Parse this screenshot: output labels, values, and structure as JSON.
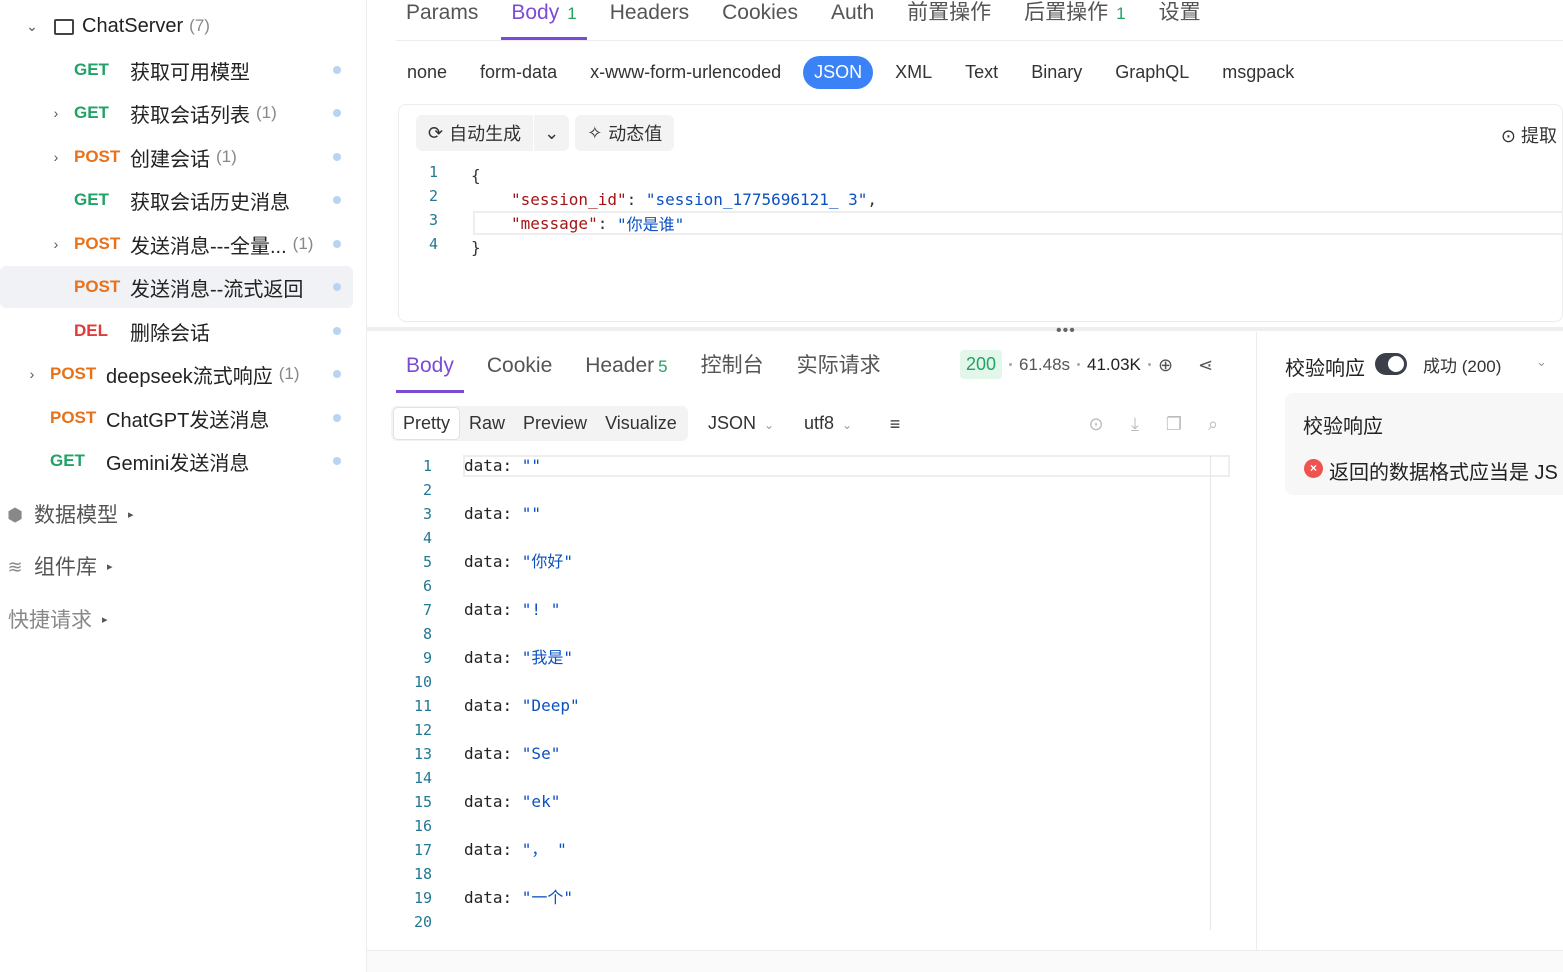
{
  "sidebar": {
    "folder": {
      "name": "ChatServer",
      "count": "(7)"
    },
    "items": [
      {
        "method": "GET",
        "name": "获取可用模型",
        "count": ""
      },
      {
        "method": "GET",
        "name": "获取会话列表",
        "count": "(1)"
      },
      {
        "method": "POST",
        "name": "创建会话",
        "count": "(1)"
      },
      {
        "method": "GET",
        "name": "获取会话历史消息",
        "count": ""
      },
      {
        "method": "POST",
        "name": "发送消息---全量...",
        "count": "(1)"
      },
      {
        "method": "POST",
        "name": "发送消息--流式返回",
        "count": ""
      },
      {
        "method": "DEL",
        "name": "删除会话",
        "count": ""
      },
      {
        "method": "POST",
        "name": "deepseek流式响应",
        "count": "(1)"
      },
      {
        "method": "POST",
        "name": "ChatGPT发送消息",
        "count": ""
      },
      {
        "method": "GET",
        "name": "Gemini发送消息",
        "count": ""
      }
    ],
    "sections": [
      "数据模型",
      "组件库",
      "快捷请求"
    ]
  },
  "request_tabs": {
    "params": "Params",
    "body": "Body",
    "body_count": "1",
    "headers": "Headers",
    "cookies": "Cookies",
    "auth": "Auth",
    "pre": "前置操作",
    "post": "后置操作",
    "post_count": "1",
    "settings": "设置"
  },
  "body_types": {
    "none": "none",
    "form_data": "form-data",
    "urlencoded": "x-www-form-urlencoded",
    "json": "JSON",
    "xml": "XML",
    "text": "Text",
    "binary": "Binary",
    "graphql": "GraphQL",
    "msgpack": "msgpack"
  },
  "editor": {
    "auto_generate": "自动生成",
    "dynamic_value": "动态值",
    "extract": "提取",
    "lines": {
      "l1": "{",
      "key1": "\"session_id\"",
      "val1": "\"session_1775696121_       3\"",
      "key2": "\"message\"",
      "val2": "\"你是谁\"",
      "l4": "}"
    }
  },
  "response_tabs": {
    "body": "Body",
    "cookie": "Cookie",
    "header": "Header",
    "header_count": "5",
    "console": "控制台",
    "actual": "实际请求"
  },
  "response_meta": {
    "status": "200",
    "time": "61.48s",
    "size": "41.03K"
  },
  "response_toolbar": {
    "pretty": "Pretty",
    "raw": "Raw",
    "preview": "Preview",
    "visualize": "Visualize",
    "format": "JSON",
    "encoding": "utf8"
  },
  "response_lines": [
    "data: \"\"",
    "",
    "data: \"\"",
    "",
    "data: \"你好\"",
    "",
    "data: \"! \"",
    "",
    "data: \"我是\"",
    "",
    "data: \"Deep\"",
    "",
    "data: \"Se\"",
    "",
    "data: \"ek\"",
    "",
    "data: \"， \"",
    "",
    "data: \"一个\"",
    ""
  ],
  "validation": {
    "title": "校验响应",
    "status": "成功 (200)",
    "box_title": "校验响应",
    "error": "返回的数据格式应当是 JS"
  },
  "colors": {
    "accent": "#7b4bd6",
    "get": "#21a366",
    "post": "#e8711a",
    "del": "#e03b3b",
    "json_active": "#3b82f6"
  }
}
